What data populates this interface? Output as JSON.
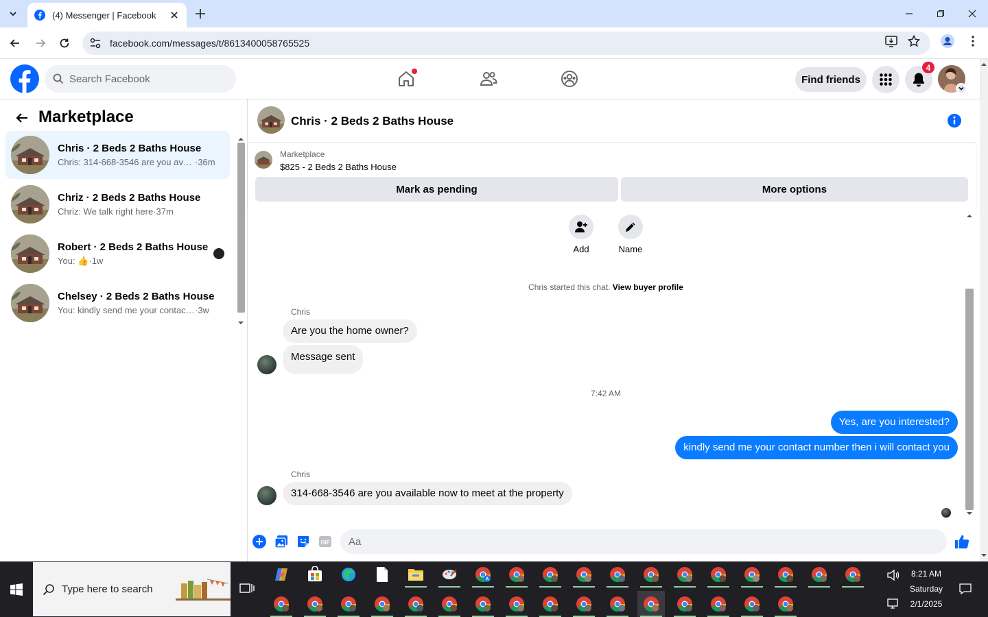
{
  "browser": {
    "tab_title": "(4) Messenger | Facebook",
    "url": "facebook.com/messages/t/8613400058765525"
  },
  "fb": {
    "search_placeholder": "Search Facebook",
    "find_friends": "Find friends",
    "notification_count": "4",
    "brand_color": "#0866ff"
  },
  "sidebar": {
    "title": "Marketplace",
    "conversations": [
      {
        "name": "Chris · 2 Beds 2 Baths House",
        "preview": "Chris: 314-668-3546 are you avai...",
        "time": "·36m",
        "active": true
      },
      {
        "name": "Chriz · 2 Beds 2 Baths House",
        "preview": "Chriz: We talk right here",
        "time": "·37m",
        "active": false
      },
      {
        "name": "Robert · 2 Beds 2 Baths House",
        "preview": "You: 👍",
        "time": "·1w",
        "active": false
      },
      {
        "name": "Chelsey · 2 Beds 2 Baths House",
        "preview": "You: kindly send me your contact ...",
        "time": "·3w",
        "active": false
      }
    ]
  },
  "chat": {
    "title": "Chris · 2 Beds 2 Baths House",
    "listing_source": "Marketplace",
    "listing_price": "$825 - 2 Beds 2 Baths House",
    "mark_pending": "Mark as pending",
    "more_options": "More options",
    "quick_add": "Add",
    "quick_name": "Name",
    "started_text": "Chris started this chat.",
    "view_profile": "View buyer profile",
    "sender_name": "Chris",
    "messages": [
      {
        "from": "Chris",
        "text": "Are you the home owner?"
      },
      {
        "from": "Chris",
        "text": "Message sent"
      },
      {
        "from": "me",
        "text": "Yes, are you interested?"
      },
      {
        "from": "me",
        "text": "kindly send me your contact number then i will contact you"
      },
      {
        "from": "Chris",
        "text": "314-668-3546 are you available now to meet at the property"
      }
    ],
    "timestamp": "7:42 AM",
    "composer_placeholder": "Aa",
    "outgoing_color": "#0a7cff"
  },
  "taskbar": {
    "search_placeholder": "Type here to search",
    "time": "8:21 AM",
    "day": "Saturday",
    "date": "2/1/2025"
  }
}
